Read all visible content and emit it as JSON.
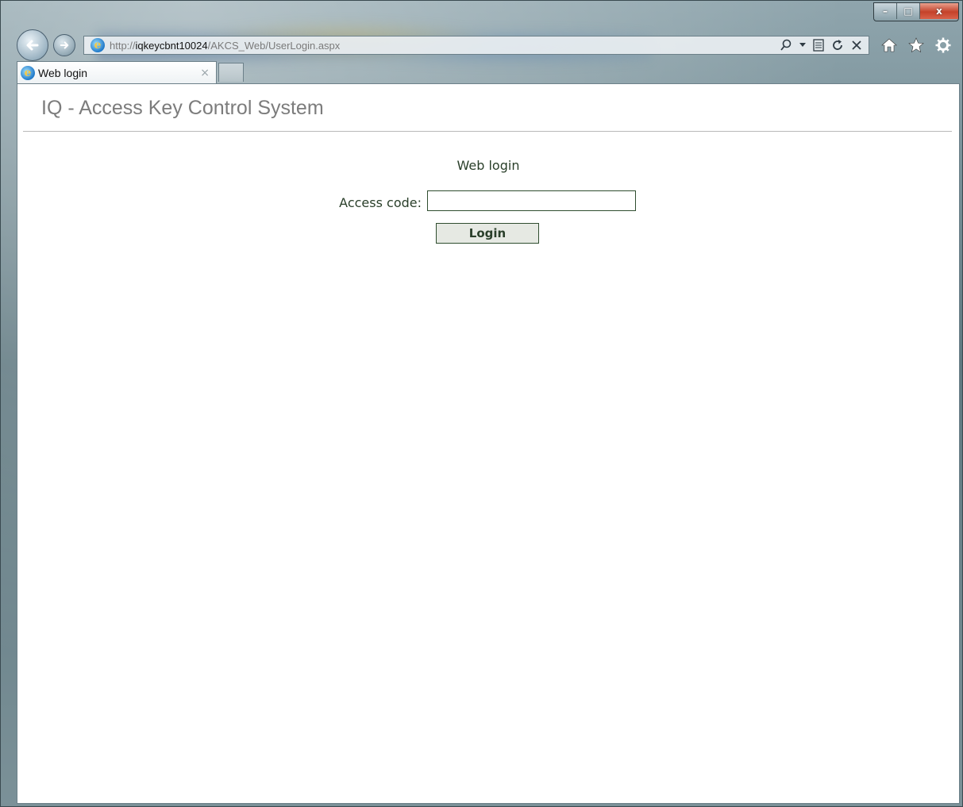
{
  "browser": {
    "url": {
      "protocol": "http://",
      "host": "iqkeycbnt10024",
      "path": "/AKCS_Web/UserLogin.aspx"
    },
    "tabs": [
      {
        "label": "Web login",
        "close": "×"
      }
    ],
    "caption": {
      "minimize": "–",
      "maximize": "□",
      "close": "x"
    },
    "icons": {
      "back": "back-arrow-icon",
      "forward": "forward-arrow-icon",
      "search": "search-icon",
      "compatibility": "compatibility-view-icon",
      "refresh": "refresh-icon",
      "stop": "stop-icon",
      "home": "home-icon",
      "favorites": "star-icon",
      "tools": "gear-icon"
    }
  },
  "page": {
    "header_title": "IQ - Access Key Control System",
    "login": {
      "heading": "Web login",
      "access_code_label": "Access code:",
      "access_code_value": "",
      "button_label": "Login"
    }
  },
  "colors": {
    "text_green": "#2a3f2a",
    "border_green": "#2f4d2f",
    "title_gray": "#7c7c7c"
  }
}
